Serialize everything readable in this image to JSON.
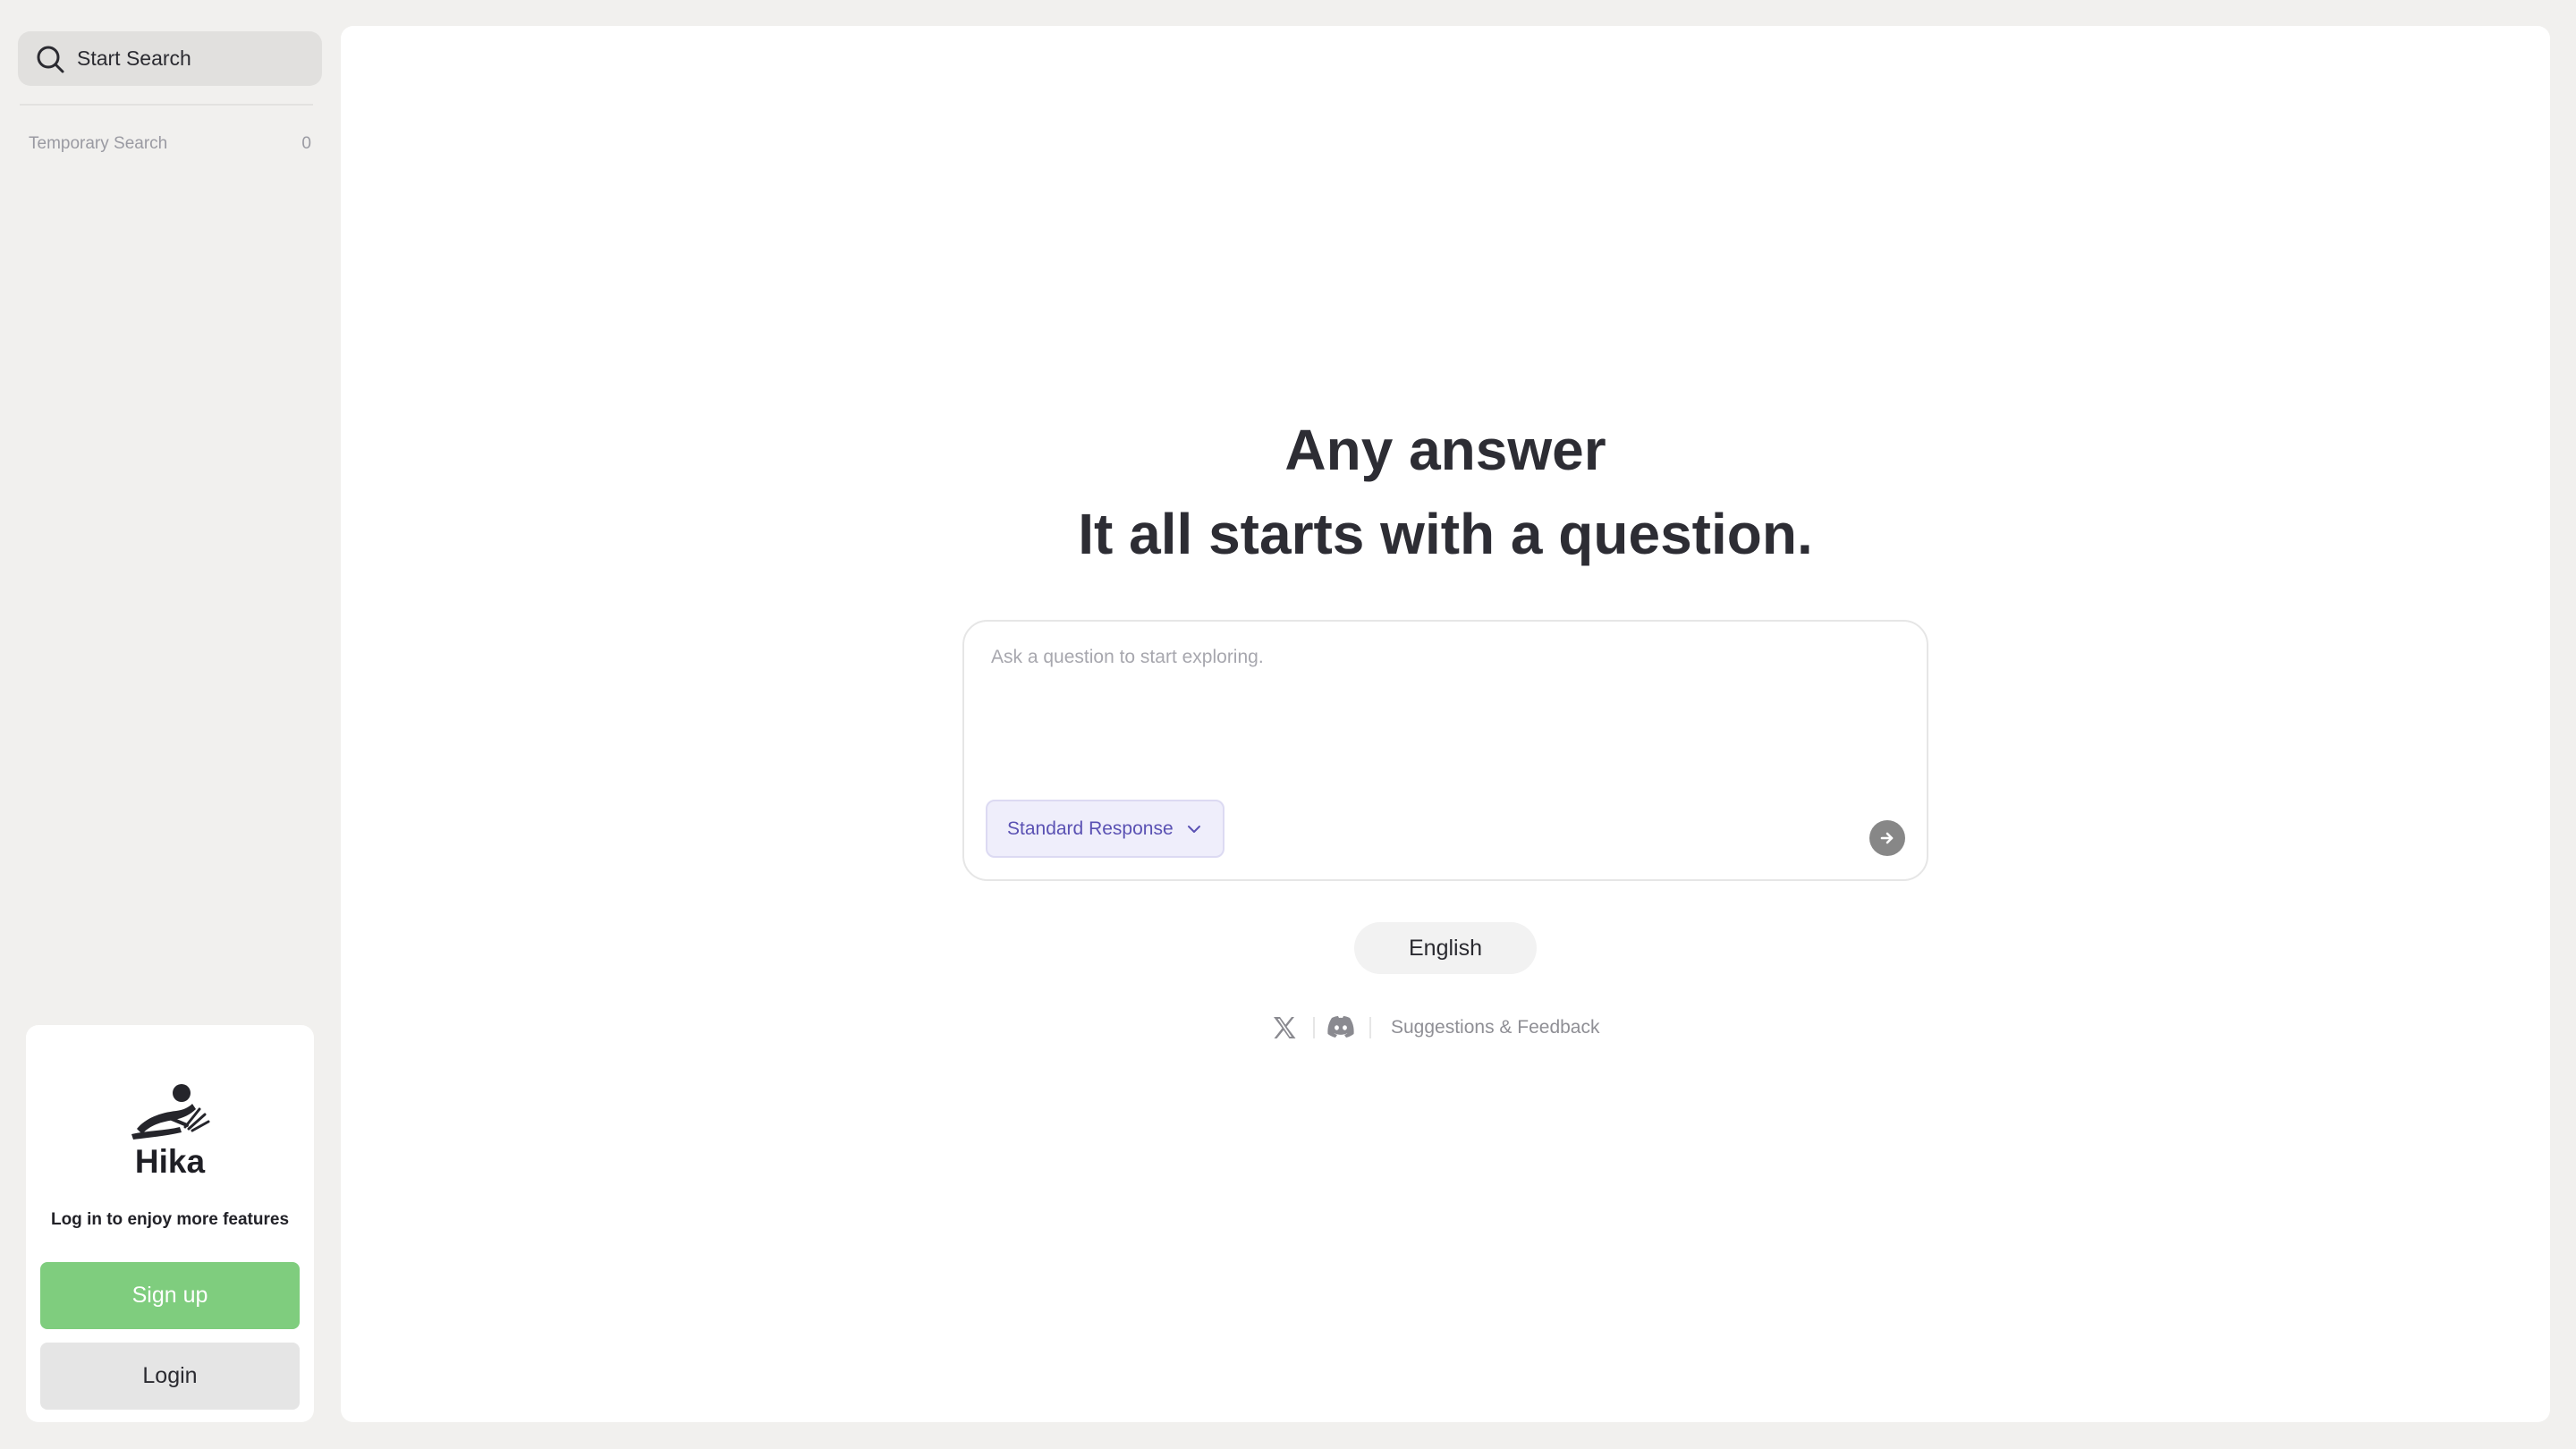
{
  "sidebar": {
    "search_button": {
      "label": "Start Search",
      "icon": "search-icon"
    },
    "temporary_search": {
      "label": "Temporary Search",
      "count": "0"
    },
    "login_card": {
      "brand": "Hika",
      "logo_icon": "hika-logo-icon",
      "tip": "Log in to enjoy more features",
      "signup_label": "Sign up",
      "login_label": "Login"
    }
  },
  "main": {
    "headline_line1": "Any answer",
    "headline_line2": "It all starts with a question.",
    "composer": {
      "placeholder": "Ask a question to start exploring.",
      "value": "",
      "mode_label": "Standard Response",
      "send_icon": "arrow-right-icon"
    },
    "language_label": "English",
    "footer": {
      "x_icon": "x-logo-icon",
      "discord_icon": "discord-icon",
      "feedback_label": "Suggestions & Feedback"
    }
  },
  "colors": {
    "background": "#f1f0ee",
    "panel": "#ffffff",
    "signup_green": "#7fcd7e",
    "mode_purple": "#5a51b3",
    "mode_bg": "#efeefb"
  }
}
